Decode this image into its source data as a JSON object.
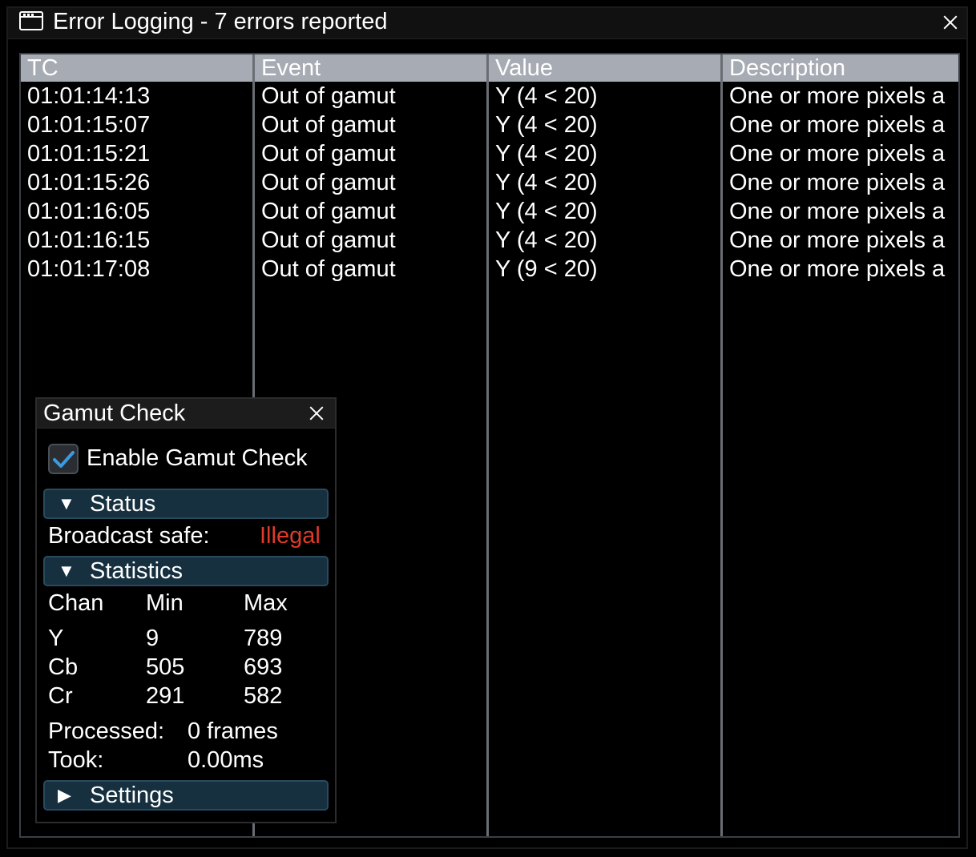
{
  "window": {
    "title": "Error Logging - 7 errors reported"
  },
  "table": {
    "columns": [
      "TC",
      "Event",
      "Value",
      "Description"
    ],
    "rows": [
      {
        "tc": "01:01:14:13",
        "event": "Out of gamut",
        "value": "Y (4 < 20)",
        "description": "One or more pixels a"
      },
      {
        "tc": "01:01:15:07",
        "event": "Out of gamut",
        "value": "Y (4 < 20)",
        "description": "One or more pixels a"
      },
      {
        "tc": "01:01:15:21",
        "event": "Out of gamut",
        "value": "Y (4 < 20)",
        "description": "One or more pixels a"
      },
      {
        "tc": "01:01:15:26",
        "event": "Out of gamut",
        "value": "Y (4 < 20)",
        "description": "One or more pixels a"
      },
      {
        "tc": "01:01:16:05",
        "event": "Out of gamut",
        "value": "Y (4 < 20)",
        "description": "One or more pixels a"
      },
      {
        "tc": "01:01:16:15",
        "event": "Out of gamut",
        "value": "Y (4 < 20)",
        "description": "One or more pixels a"
      },
      {
        "tc": "01:01:17:08",
        "event": "Out of gamut",
        "value": "Y (9 < 20)",
        "description": "One or more pixels a"
      }
    ]
  },
  "panel": {
    "title": "Gamut Check",
    "enable_label": "Enable Gamut Check",
    "enabled": true,
    "status": {
      "header": "Status",
      "broadcast_label": "Broadcast safe:",
      "broadcast_value": "Illegal",
      "broadcast_color": "#e03a2a"
    },
    "statistics": {
      "header": "Statistics",
      "headers": [
        "Chan",
        "Min",
        "Max"
      ],
      "rows": [
        {
          "chan": "Y",
          "min": "9",
          "max": "789"
        },
        {
          "chan": "Cb",
          "min": "505",
          "max": "693"
        },
        {
          "chan": "Cr",
          "min": "291",
          "max": "582"
        }
      ],
      "processed_label": "Processed:",
      "processed_value": "0 frames",
      "took_label": "Took:",
      "took_value": "0.00ms"
    },
    "settings": {
      "header": "Settings"
    }
  },
  "icons": {
    "window": "window-icon",
    "close": "close-icon",
    "check": "checkmark-icon",
    "expanded": "triangle-down-icon",
    "collapsed": "triangle-right-icon"
  }
}
